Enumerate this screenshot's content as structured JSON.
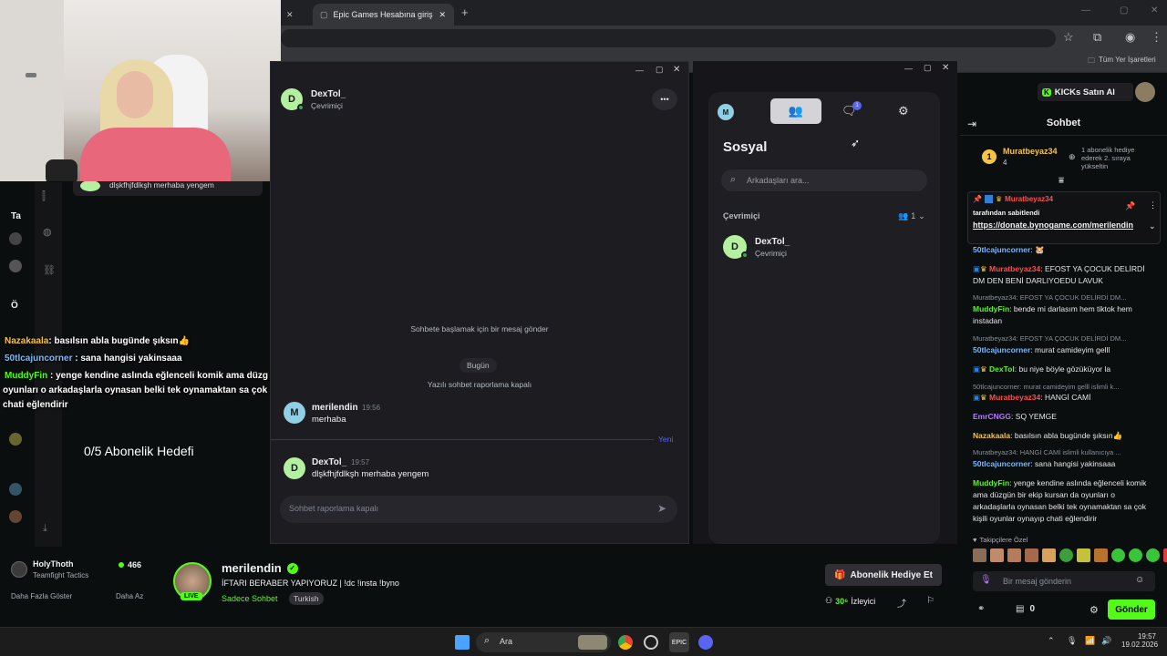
{
  "browser": {
    "tabs": [
      {
        "label": ""
      },
      {
        "label": "Epic Games Hesabına giriş yap"
      }
    ],
    "new_tab": "+",
    "bookmarks_all": "Tüm Yer İşaretleri"
  },
  "overlay": {
    "chat_lines": [
      {
        "user": "Nazakaala",
        "text": ": basılsın abla bugünde şıksın👍",
        "color": "#f5c542"
      },
      {
        "user": "50tlcajuncorner",
        "text": " : sana hangisi yakinsaaa",
        "color": "#7ab8ff"
      },
      {
        "user": "MuddyFin",
        "text": " : yenge kendine aslında eğlenceli komik ama düzg",
        "color": "#53fc18"
      }
    ],
    "chat_wrap_1": "oyunları o arkadaşlarla oynasan belki tek oynamaktan sa çok",
    "chat_wrap_2": "chati eğlendirir",
    "sub_goal": "0/5 Abonelik Hedefi",
    "partial_msg": "dlşkfhjfdlkşh merhaba yengem",
    "side_labels": [
      "Ta",
      "Ö"
    ]
  },
  "dm": {
    "contact_initial": "D",
    "contact_name": "DexTol_",
    "contact_status": "Çevrimiçi",
    "more_label": "•••",
    "start_hint": "Sohbete başlamak için bir mesaj gönder",
    "today": "Bugün",
    "report_off": "Yazılı sohbet raporlama kapalı",
    "messages": [
      {
        "initial": "M",
        "user": "merilendin",
        "time": "19:56",
        "text": "merhaba",
        "color": "#8fd0e6"
      },
      {
        "initial": "D",
        "user": "DexTol_",
        "time": "19:57",
        "text": "dlşkfhjfdlkşh merhaba yengem",
        "color": "#b5f0a0"
      }
    ],
    "new_label": "Yeni",
    "input_placeholder": "Sohbet raporlama kapalı"
  },
  "social": {
    "title": "Sosyal",
    "search_placeholder": "Arkadaşları ara...",
    "online_header": "Çevrimiçi",
    "online_count": "1",
    "badge_count": "1",
    "friend_initial": "D",
    "friend_name": "DexTol_",
    "friend_status": "Çevrimiçi",
    "self_initial": "M"
  },
  "stream": {
    "streamer": "merilendin",
    "live": "LIVE",
    "title": "İFTARI BERABER YAPIYORUZ | !dc !insta !byno",
    "chat_mode": "Sadece Sohbet",
    "language": "Turkish",
    "viewers": "30⁶",
    "viewers_label": "İzleyici",
    "gift_sub": "Abonelik Hediye Et",
    "side_channel": "HolyThoth",
    "side_game": "Teamfight Tactics",
    "side_viewers": "466",
    "show_more": "Daha Fazla Göster",
    "show_less": "Daha Az"
  },
  "chat": {
    "kicks_btn": "KICKs Satın Al",
    "header": "Sohbet",
    "top_gifter": "Muratbeyaz34",
    "top_gifter_count": "4",
    "gifter_note": "1 abonelik hediye ederek 2. sıraya yükseltin",
    "pinned_user": "Muratbeyaz34",
    "pinned_by": "tarafından sabitlendi",
    "pinned_link": "https://donate.bynogame.com/merilendin",
    "lines": [
      {
        "reply": "",
        "user": "50tlcajuncorner",
        "ucolor": "#7ab8ff",
        "text": ": 🐹"
      },
      {
        "reply": "",
        "user": "Muratbeyaz34",
        "ucolor": "#ff4d4d",
        "text": ": EFOST YA ÇOCUK DELİRDİ DM DEN BENİ DARLIYOEDU LAVUK"
      },
      {
        "reply": "Muratbeyaz34: EFOST YA ÇOCUK DELİRDİ DM...",
        "user": "MuddyFin",
        "ucolor": "#53fc18",
        "text": ": bende mi darlasım hem tiktok hem instadan"
      },
      {
        "reply": "Muratbeyaz34: EFOST YA ÇOCUK DELİRDİ DM...",
        "user": "50tlcajuncorner",
        "ucolor": "#7ab8ff",
        "text": ": murat camideyim gelll"
      },
      {
        "reply": "",
        "user": "DexTol",
        "ucolor": "#53fc18",
        "text": ": bu niye böyle gözüküyor la"
      },
      {
        "reply": "50tlcajuncorner: murat camideyim gelll islimli k...",
        "user": "Muratbeyaz34",
        "ucolor": "#ff4d4d",
        "text": ": HANGİ CAMİ"
      },
      {
        "reply": "",
        "user": "EmrCNGG",
        "ucolor": "#b57bff",
        "text": ": SQ YEMGE"
      },
      {
        "reply": "",
        "user": "Nazakaala",
        "ucolor": "#f5c542",
        "text": ": basılsın abla bugünde şıksın👍"
      },
      {
        "reply": "Muratbeyaz34: HANGİ CAMİ islimli kullanıcıya ...",
        "user": "50tlcajuncorner",
        "ucolor": "#7ab8ff",
        "text": ": sana hangisi yakinsaaa"
      },
      {
        "reply": "",
        "user": "MuddyFin",
        "ucolor": "#53fc18",
        "text": ": yenge kendine aslında eğlenceli komik ama düzgün bir ekip kursan da oyunları o arkadaşlarla oynasan belki tek oynamaktan sa çok kişili oyunlar oynayıp chati eğlendirir"
      }
    ],
    "followers_label": "Takipçilere Özel",
    "input_placeholder": "Bir mesaj gönderin",
    "kicks_count": "0",
    "send": "Gönder"
  },
  "taskbar": {
    "search": "Ara",
    "time": "19:57",
    "date": "19.02.2026"
  }
}
